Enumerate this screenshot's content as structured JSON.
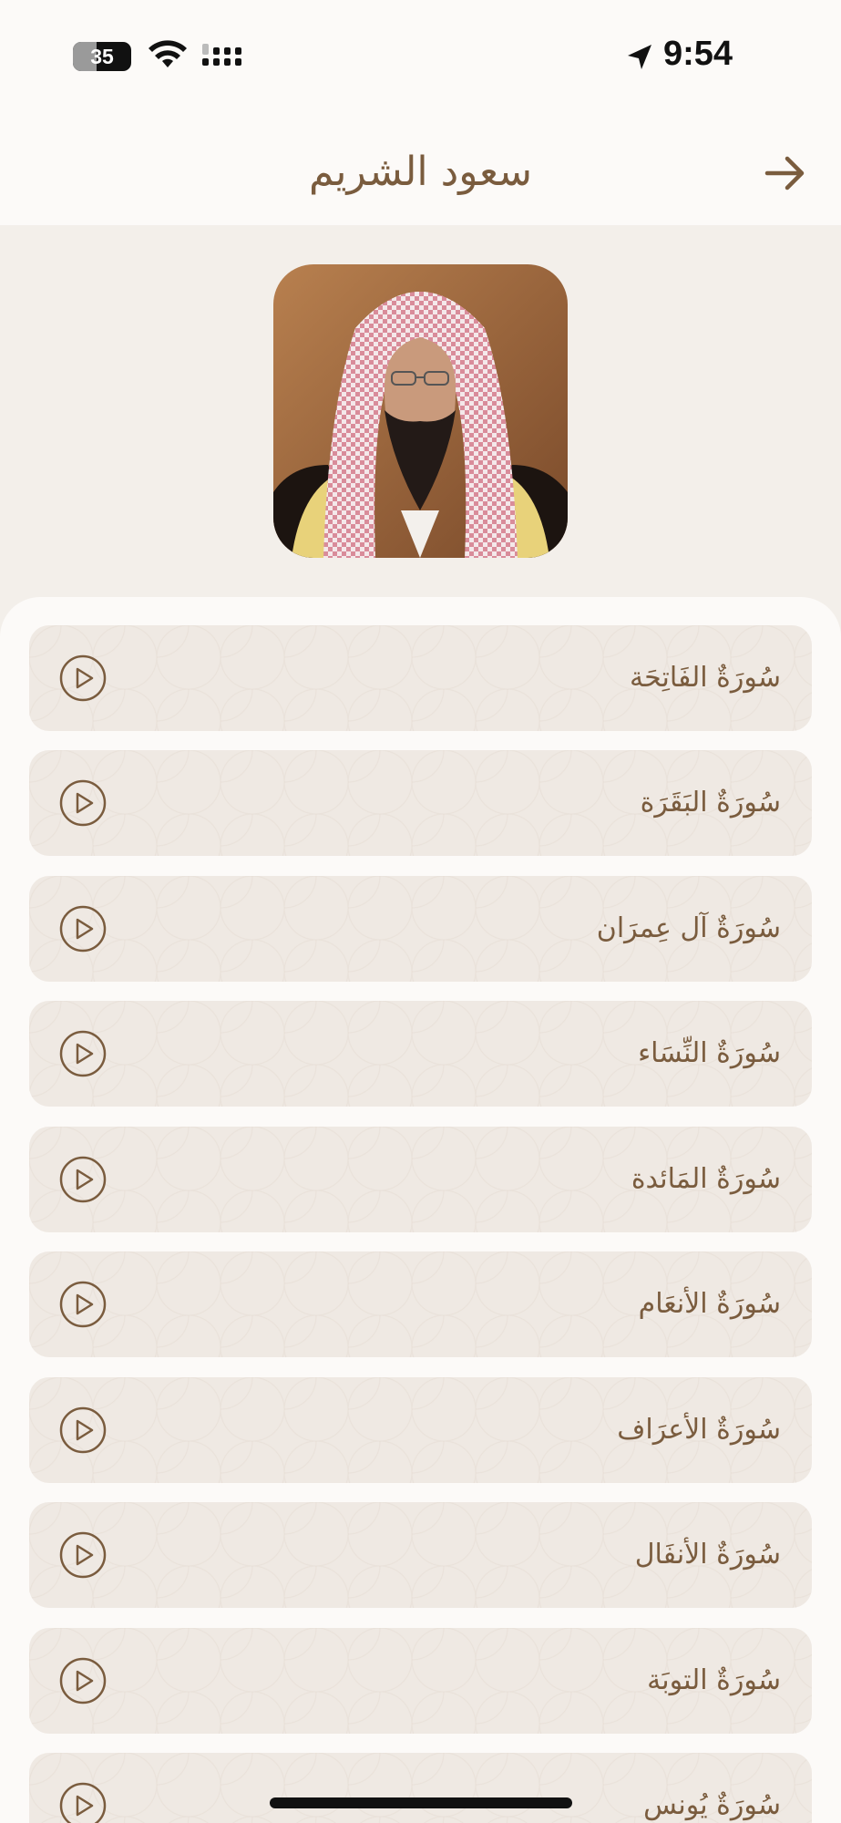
{
  "status_bar": {
    "battery": "35",
    "time": "9:54"
  },
  "header": {
    "title": "سعود الشريم"
  },
  "surahs": [
    "سُورَةٌ الفَاتِحَة",
    "سُورَةٌ البَقَرَة",
    "سُورَةٌ آل عِمرَان",
    "سُورَةٌ النِّسَاء",
    "سُورَةٌ المَائدة",
    "سُورَةٌ الأنعَام",
    "سُورَةٌ الأعرَاف",
    "سُورَةٌ الأنفَال",
    "سُورَةٌ التوبَة",
    "سُورَةٌ يُونس"
  ],
  "colors": {
    "accent": "#7a5c3e",
    "background": "#f3efea",
    "surface": "#fcfaf8",
    "card": "#efe9e3"
  },
  "icons": {
    "back": "arrow-right-icon",
    "play": "play-circle-icon"
  }
}
